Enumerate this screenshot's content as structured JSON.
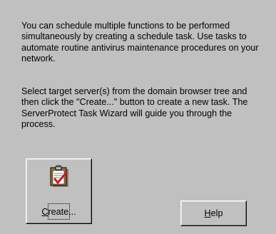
{
  "intro": {
    "lines": [
      "You can schedule multiple functions to be performed",
      "simultaneously by creating a schedule task. Use tasks to",
      "automate routine antivirus maintenance procedures on your",
      "network."
    ]
  },
  "instructions": {
    "lines": [
      "Select target server(s) from the domain browser tree and",
      "then click the \"Create...\" button to create a new task. The",
      "ServerProtect Task Wizard will guide you through the",
      "process."
    ]
  },
  "create_button": {
    "accel": "C",
    "rest": "reate...",
    "icon": "task-clipboard-icon"
  },
  "help_button": {
    "accel": "H",
    "rest": "elp"
  },
  "colors": {
    "background": "#c0c0c0",
    "text": "#000000",
    "checkmark": "#d01818"
  }
}
